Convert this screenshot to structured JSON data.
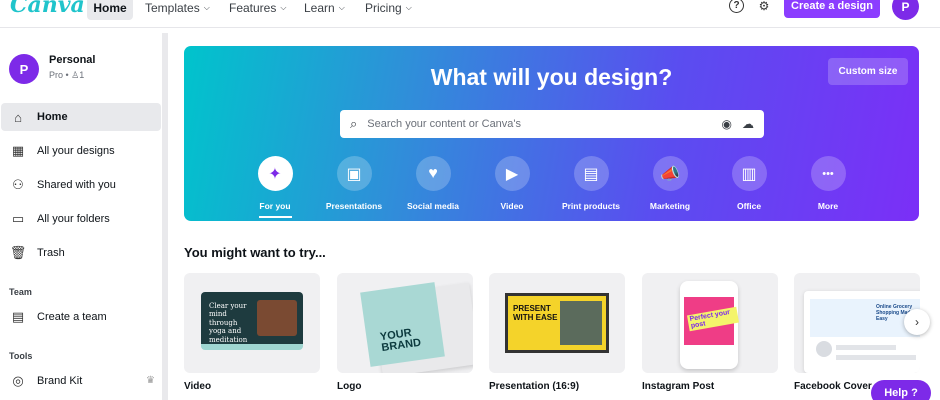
{
  "app": {
    "logo": "Canva",
    "brand_color": "#7d2ae8",
    "cta_color": "#8b3dff"
  },
  "topnav": {
    "home": "Home",
    "templates": "Templates",
    "features": "Features",
    "learn": "Learn",
    "pricing": "Pricing",
    "chevron": "⌵",
    "help_icon": "?",
    "settings_icon": "⚙",
    "create_design": "Create a design",
    "avatar_letter": "P"
  },
  "sidebar": {
    "profile": {
      "avatar_letter": "P",
      "name": "Personal",
      "meta": "Pro • ♙1"
    },
    "items": [
      {
        "label": "Home",
        "icon": "home-icon",
        "glyph": "⌂"
      },
      {
        "label": "All your designs",
        "icon": "grid-icon",
        "glyph": "▦"
      },
      {
        "label": "Shared with you",
        "icon": "people-icon",
        "glyph": "⚇"
      },
      {
        "label": "All your folders",
        "icon": "folder-icon",
        "glyph": "▭"
      },
      {
        "label": "Trash",
        "icon": "trash-icon",
        "glyph": "🗑"
      }
    ],
    "team_section": "Team",
    "team_item": {
      "label": "Create a team",
      "icon": "building-icon",
      "glyph": "▤"
    },
    "tools_section": "Tools",
    "tools_item": {
      "label": "Brand Kit",
      "icon": "brand-kit-icon",
      "glyph": "◎",
      "crown": "♛"
    }
  },
  "hero": {
    "title": "What will you design?",
    "custom_size": "Custom size",
    "search_placeholder": "Search your content or Canva's",
    "search_glyph": "⌕",
    "camera_glyph": "◉",
    "upload_glyph": "☁",
    "categories": [
      {
        "label": "For you",
        "icon": "sparkle-icon",
        "glyph": "✦",
        "active": true
      },
      {
        "label": "Presentations",
        "icon": "presentation-icon",
        "glyph": "▣"
      },
      {
        "label": "Social media",
        "icon": "heart-bubble-icon",
        "glyph": "♥"
      },
      {
        "label": "Video",
        "icon": "video-camera-icon",
        "glyph": "▶"
      },
      {
        "label": "Print products",
        "icon": "printer-icon",
        "glyph": "▤"
      },
      {
        "label": "Marketing",
        "icon": "megaphone-icon",
        "glyph": "📣"
      },
      {
        "label": "Office",
        "icon": "briefcase-icon",
        "glyph": "▥"
      },
      {
        "label": "More",
        "icon": "more-icon",
        "glyph": "•••"
      }
    ]
  },
  "suggestions": {
    "title": "You might want to try...",
    "cards": [
      {
        "label": "Video",
        "thumb_text": "Clear your mind through yoga and meditation"
      },
      {
        "label": "Logo",
        "thumb_text": "YOUR BRAND"
      },
      {
        "label": "Presentation (16:9)",
        "thumb_text": "PRESENT WITH EASE"
      },
      {
        "label": "Instagram Post",
        "thumb_text": "Perfect your post"
      },
      {
        "label": "Facebook Cover",
        "thumb_text": "Online Grocery Shopping Made Easy"
      }
    ],
    "next_glyph": "›"
  },
  "help_button": "Help ?"
}
